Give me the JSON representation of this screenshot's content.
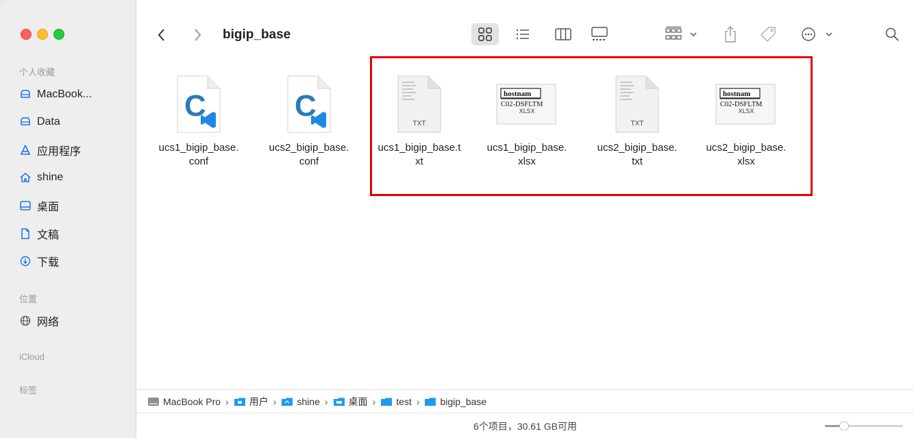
{
  "window": {
    "title": "bigip_base"
  },
  "sidebar": {
    "favorites_label": "个人收藏",
    "favorites": [
      {
        "label": "MacBook...",
        "icon": "drive-icon"
      },
      {
        "label": "Data",
        "icon": "drive-icon"
      },
      {
        "label": "应用程序",
        "icon": "applications-icon"
      },
      {
        "label": "shine",
        "icon": "home-icon"
      },
      {
        "label": "桌面",
        "icon": "desktop-icon"
      },
      {
        "label": "文稿",
        "icon": "document-icon"
      },
      {
        "label": "下载",
        "icon": "download-icon"
      }
    ],
    "locations_label": "位置",
    "locations": [
      {
        "label": "网络",
        "icon": "network-icon"
      }
    ],
    "icloud_label": "iCloud",
    "tags_label": "标签"
  },
  "files": [
    {
      "name": "ucs1_bigip_base.\nconf",
      "type": "conf",
      "icon": "vscode-c-file-icon"
    },
    {
      "name": "ucs2_bigip_base.\nconf",
      "type": "conf",
      "icon": "vscode-c-file-icon"
    },
    {
      "name": "ucs1_bigip_base.t\nxt",
      "type": "txt",
      "icon": "txt-file-icon",
      "badge": "TXT"
    },
    {
      "name": "ucs1_bigip_base.\nxlsx",
      "type": "xlsx",
      "icon": "xlsx-file-icon",
      "badge": "XLSX",
      "preview_lines": [
        "hostnam",
        "C02-DSFLTM"
      ]
    },
    {
      "name": "ucs2_bigip_base.\ntxt",
      "type": "txt",
      "icon": "txt-file-icon",
      "badge": "TXT"
    },
    {
      "name": "ucs2_bigip_base.\nxlsx",
      "type": "xlsx",
      "icon": "xlsx-file-icon",
      "badge": "XLSX",
      "preview_lines": [
        "hostnam",
        "C02-DSFLTM"
      ]
    }
  ],
  "pathbar": [
    {
      "label": "MacBook Pro",
      "icon": "disk-icon"
    },
    {
      "label": "用户",
      "icon": "folder-icon"
    },
    {
      "label": "shine",
      "icon": "folder-icon"
    },
    {
      "label": "桌面",
      "icon": "folder-icon"
    },
    {
      "label": "test",
      "icon": "folder-icon"
    },
    {
      "label": "bigip_base",
      "icon": "folder-icon"
    }
  ],
  "status": {
    "text": "6个项目，30.61 GB可用"
  },
  "colors": {
    "highlight": "#e60000",
    "folder": "#1d9bf0",
    "accent": "#0a84ff"
  }
}
